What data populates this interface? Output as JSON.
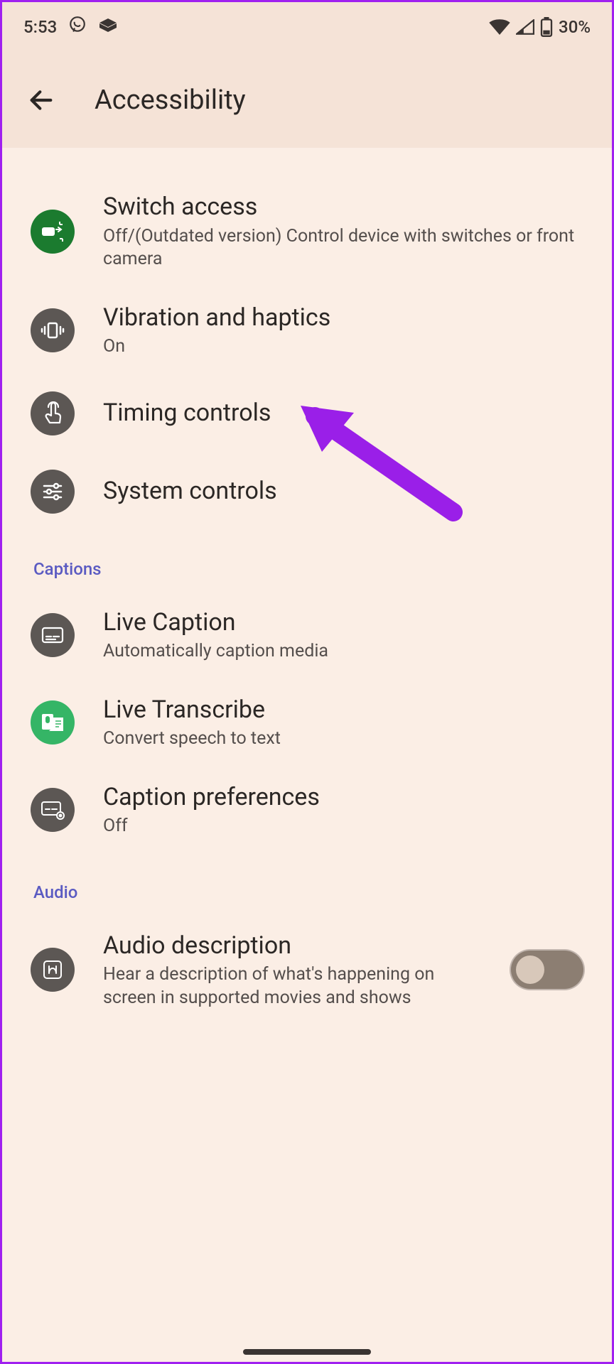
{
  "status": {
    "time": "5:53",
    "battery": "30%"
  },
  "header": {
    "title": "Accessibility"
  },
  "sections": {
    "interaction_controls": {
      "switch_access": {
        "title": "Switch access",
        "subtitle": "Off/(Outdated version) Control device with switches or front camera"
      },
      "vibration": {
        "title": "Vibration and haptics",
        "subtitle": "On"
      },
      "timing": {
        "title": "Timing controls"
      },
      "system": {
        "title": "System controls"
      }
    },
    "captions_header": "Captions",
    "captions": {
      "live_caption": {
        "title": "Live Caption",
        "subtitle": "Automatically caption media"
      },
      "live_transcribe": {
        "title": "Live Transcribe",
        "subtitle": "Convert speech to text"
      },
      "caption_prefs": {
        "title": "Caption preferences",
        "subtitle": "Off"
      }
    },
    "audio_header": "Audio",
    "audio": {
      "audio_description": {
        "title": "Audio description",
        "subtitle": "Hear a description of what's happening on screen in supported movies and shows"
      }
    }
  }
}
